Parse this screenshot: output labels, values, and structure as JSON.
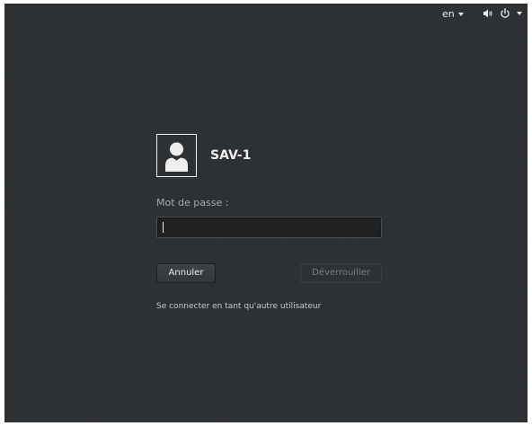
{
  "topbar": {
    "language": "en",
    "volume_icon": "volume-icon",
    "power_icon": "power-icon"
  },
  "login": {
    "username": "SAV-1",
    "password_label": "Mot de passe :",
    "password_value": "",
    "cancel_label": "Annuler",
    "unlock_label": "Déverrouiller",
    "switch_user_label": "Se connecter en tant qu'autre utilisateur",
    "avatar_icon": "user-avatar-icon"
  },
  "colors": {
    "background": "#2e3134",
    "text": "#eeeeee",
    "label": "#a6a9ab",
    "disabled_text": "#7c7f81",
    "field_bg": "#1f2123"
  }
}
